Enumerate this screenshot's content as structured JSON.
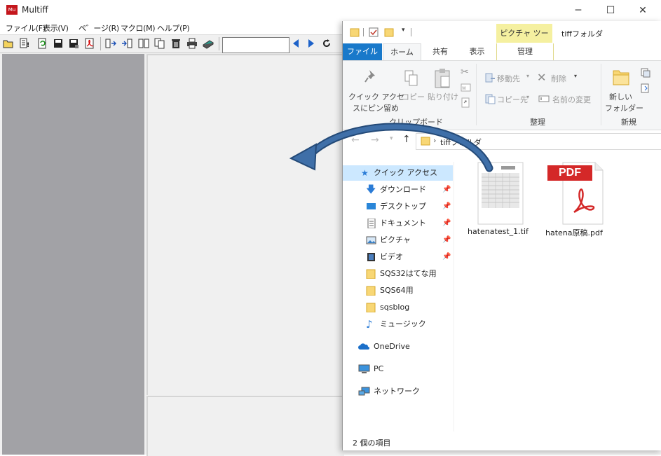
{
  "multiff": {
    "title": "Multiff",
    "app_icon_text": "Mu",
    "menus": [
      "ファイル(F)",
      "表示(V)",
      "ペ゛ージ(R)",
      "マクロ(M)",
      "ヘルプ(P)"
    ],
    "page_input_value": ""
  },
  "explorer": {
    "context_tab": "ピクチャ ツール",
    "window_title": "tiffフォルダ",
    "tabs": [
      "ファイル",
      "ホーム",
      "共有",
      "表示",
      "管理"
    ],
    "ribbon": {
      "pin_line1": "クイック アクセ",
      "pin_line2": "スにピン留め",
      "copy": "コピー",
      "paste": "貼り付け",
      "clipboard_group": "クリップボード",
      "move_to": "移動先",
      "copy_to": "コピー先",
      "delete": "削除",
      "rename": "名前の変更",
      "organize_group": "整理",
      "new_folder_line1": "新しい",
      "new_folder_line2": "フォルダー",
      "new_group": "新規"
    },
    "address": {
      "path": "tiffフォルダ"
    },
    "nav": {
      "quick_access": "クイック アクセス",
      "downloads": "ダウンロード",
      "desktop": "デスクトップ",
      "documents": "ドキュメント",
      "pictures": "ピクチャ",
      "videos": "ビデオ",
      "sqs32": "SQS32はてな用",
      "sqs64": "SQS64用",
      "sqsblog": "sqsblog",
      "music": "ミュージック",
      "onedrive": "OneDrive",
      "pc": "PC",
      "network": "ネットワーク"
    },
    "files": [
      {
        "name": "hatenatest_1.tif",
        "icon": "tif-thumbnail-icon"
      },
      {
        "name": "hatena原稿.pdf",
        "icon": "pdf-icon",
        "badge": "PDF"
      }
    ],
    "status": "2 個の項目"
  },
  "colors": {
    "accent": "#1979ca",
    "picture_tools": "#f5f0a0",
    "selected_nav": "#cce8ff",
    "arrow": "#2f5e94"
  }
}
